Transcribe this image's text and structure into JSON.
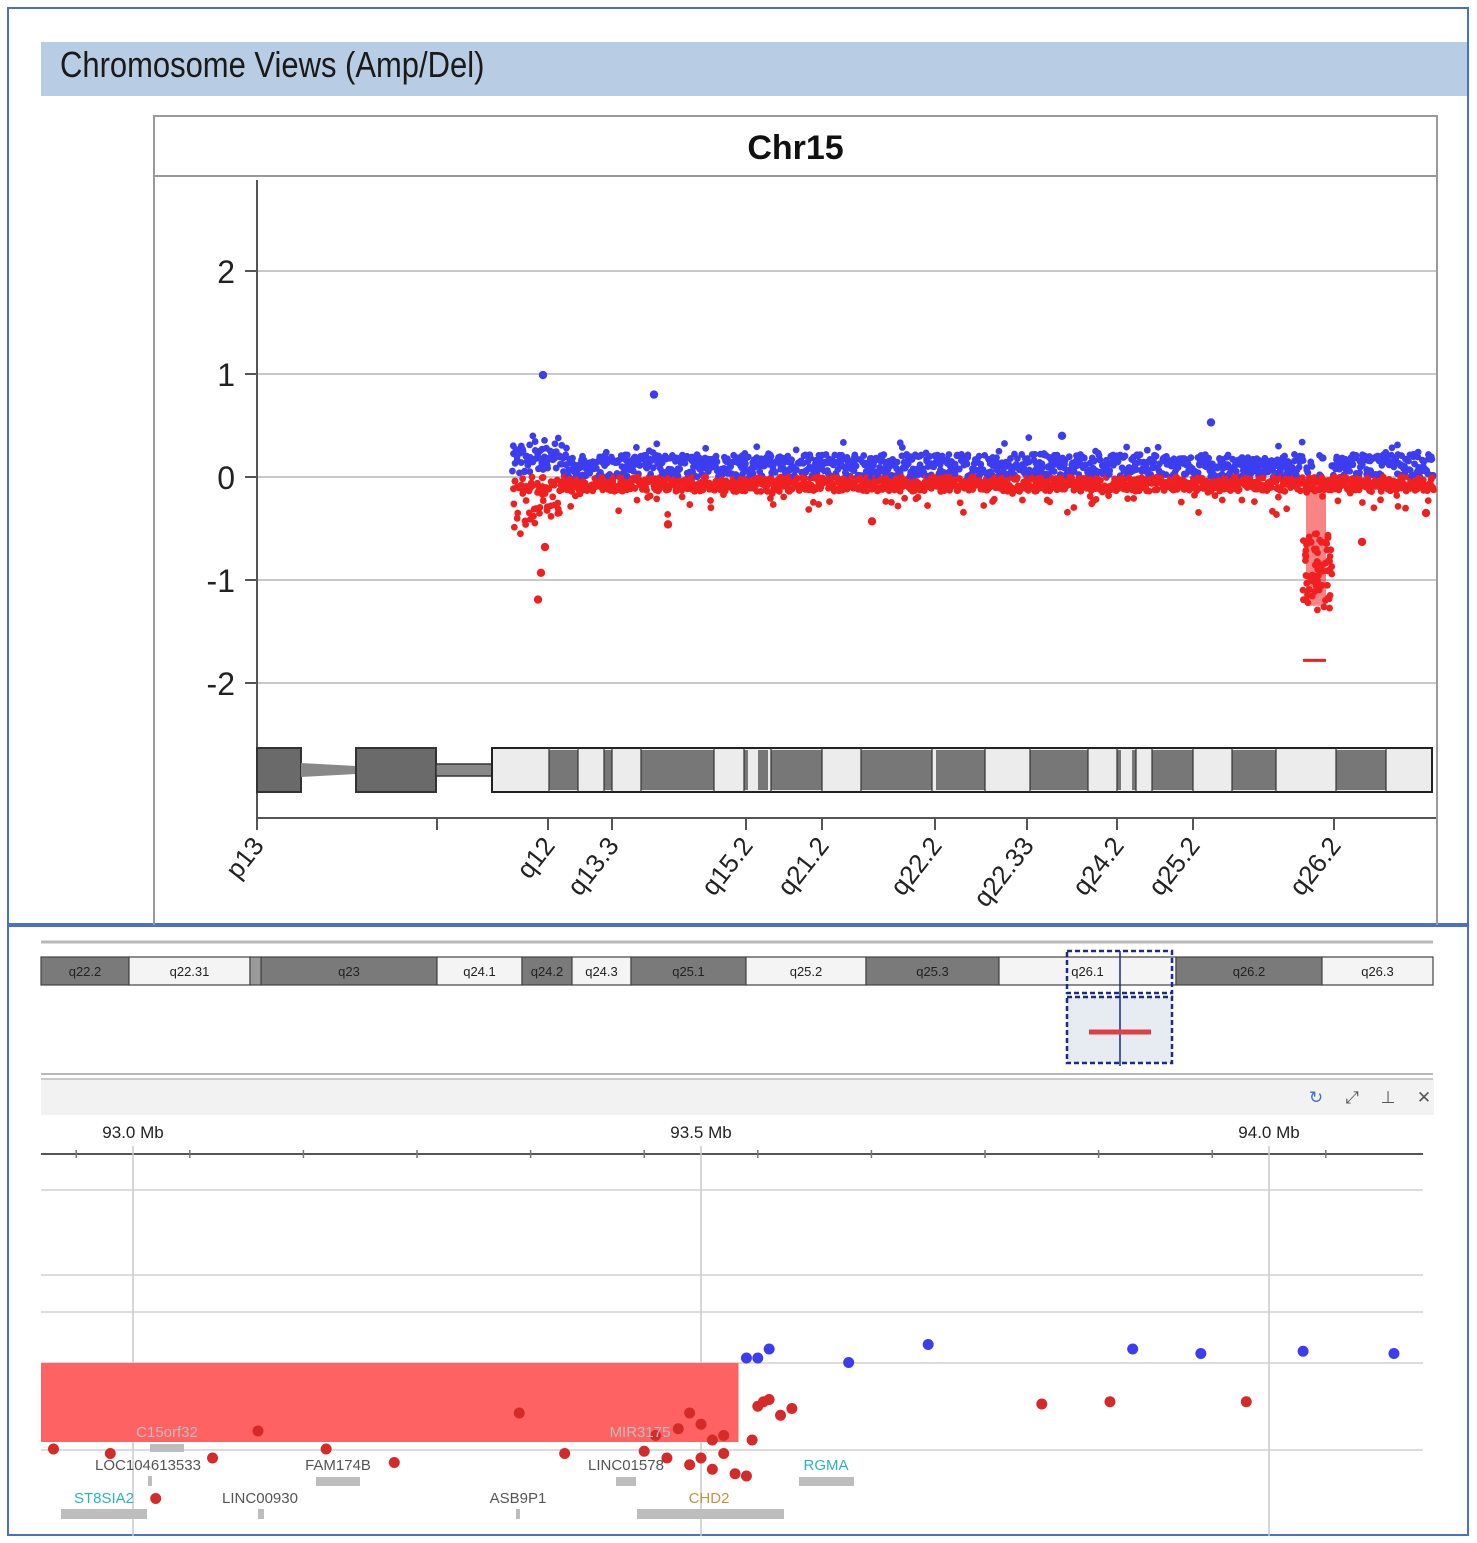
{
  "header": {
    "title": "Chromosome Views (Amp/Del)"
  },
  "chart_data": [
    {
      "type": "scatter",
      "title": "Chr15",
      "ylim": [
        -2.6,
        2.6
      ],
      "yticks": [
        "2",
        "1",
        "0",
        "-1",
        "-2"
      ],
      "ytick_values": [
        2,
        1,
        0,
        -1,
        -2
      ],
      "grid": true,
      "x_tick_labels": [
        "p13",
        "q12",
        "q13.3",
        "q15.2",
        "q21.2",
        "q22.2",
        "q22.33",
        "q24.2",
        "q25.2",
        "q26.2"
      ],
      "series": [
        {
          "color": "#3c3cf0",
          "description_only": true
        },
        {
          "color": "#f02020"
        }
      ],
      "data_start_band": "q12",
      "notable_points": [
        {
          "band": "q12",
          "value": 1.05,
          "sign": "amp"
        },
        {
          "band": "q13.3",
          "value": 0.83,
          "sign": "amp"
        },
        {
          "band": "q25.2",
          "value": 0.55,
          "sign": "amp"
        },
        {
          "band": "q12",
          "value": -1.25,
          "sign": "del"
        },
        {
          "band": "q12",
          "value": -0.95,
          "sign": "del"
        }
      ],
      "deletion_segment": {
        "band": "q26.1",
        "value": -1.0
      },
      "deletion_marker": {
        "band": "q26.1",
        "value": -2.0
      }
    },
    {
      "type": "scatter",
      "x_tick_labels": [
        "93.0 Mb",
        "93.5 Mb",
        "94.0 Mb"
      ],
      "x_ticks": [
        93.0,
        93.5,
        94.0
      ],
      "xlim": [
        92.92,
        94.13
      ],
      "deletion_region": {
        "x_start": 92.92,
        "x_end": 93.533
      },
      "blue_points": [
        {
          "x": 93.54,
          "y": 1.0
        },
        {
          "x": 93.55,
          "y": 1.0
        },
        {
          "x": 93.56,
          "y": 1.2
        },
        {
          "x": 93.63,
          "y": 0.9
        },
        {
          "x": 93.7,
          "y": 1.3
        },
        {
          "x": 93.88,
          "y": 1.2
        },
        {
          "x": 93.94,
          "y": 1.1
        },
        {
          "x": 94.03,
          "y": 1.15
        },
        {
          "x": 94.11,
          "y": 1.1
        }
      ],
      "red_points": [
        {
          "x": 92.93,
          "y": -0.2
        },
        {
          "x": 92.98,
          "y": -0.3
        },
        {
          "x": 93.02,
          "y": -1.3
        },
        {
          "x": 93.07,
          "y": -0.4
        },
        {
          "x": 93.11,
          "y": 0.2
        },
        {
          "x": 93.17,
          "y": -0.2
        },
        {
          "x": 93.23,
          "y": -0.5
        },
        {
          "x": 93.34,
          "y": 0.6
        },
        {
          "x": 93.38,
          "y": -0.3
        },
        {
          "x": 93.45,
          "y": -0.25
        },
        {
          "x": 93.46,
          "y": 0.1
        },
        {
          "x": 93.47,
          "y": -0.4
        },
        {
          "x": 93.48,
          "y": 0.25
        },
        {
          "x": 93.49,
          "y": 0.6
        },
        {
          "x": 93.49,
          "y": -0.55
        },
        {
          "x": 93.5,
          "y": 0.35
        },
        {
          "x": 93.5,
          "y": -0.4
        },
        {
          "x": 93.51,
          "y": 0.0
        },
        {
          "x": 93.51,
          "y": -0.65
        },
        {
          "x": 93.52,
          "y": -0.3
        },
        {
          "x": 93.52,
          "y": 0.1
        },
        {
          "x": 93.53,
          "y": -0.75
        },
        {
          "x": 93.54,
          "y": -0.8
        },
        {
          "x": 93.545,
          "y": 0.0
        },
        {
          "x": 93.55,
          "y": 0.75
        },
        {
          "x": 93.555,
          "y": 0.85
        },
        {
          "x": 93.56,
          "y": 0.9
        },
        {
          "x": 93.57,
          "y": 0.55
        },
        {
          "x": 93.58,
          "y": 0.7
        },
        {
          "x": 93.8,
          "y": 0.8
        },
        {
          "x": 93.86,
          "y": 0.85
        },
        {
          "x": 93.98,
          "y": 0.85
        }
      ]
    }
  ],
  "ideogram": {
    "bands": [
      {
        "label": "q22.2",
        "dark": true
      },
      {
        "label": "q22.31",
        "dark": false
      },
      {
        "label": "q23",
        "dark": true
      },
      {
        "label": "q24.1",
        "dark": false
      },
      {
        "label": "q24.2",
        "dark": true
      },
      {
        "label": "q24.3",
        "dark": false
      },
      {
        "label": "q25.1",
        "dark": true
      },
      {
        "label": "q25.2",
        "dark": false
      },
      {
        "label": "q25.3",
        "dark": true
      },
      {
        "label": "q26.1",
        "dark": false
      },
      {
        "label": "q26.2",
        "dark": true
      },
      {
        "label": "q26.3",
        "dark": false
      }
    ]
  },
  "genes": [
    {
      "name": "LOC104613533",
      "color": "#555555"
    },
    {
      "name": "FAM174B",
      "color": "#555555"
    },
    {
      "name": "LINC01578",
      "color": "#555555"
    },
    {
      "name": "RGMA",
      "color": "#2ab5b5"
    },
    {
      "name": "ST8SIA2",
      "color": "#2ab5b5"
    },
    {
      "name": "LINC00930",
      "color": "#555555"
    },
    {
      "name": "ASB9P1",
      "color": "#555555"
    },
    {
      "name": "CHD2",
      "color": "#c89040"
    },
    {
      "name": "C15orf32",
      "color": "#bdbdbd"
    },
    {
      "name": "MIR3175",
      "color": "#bdbdbd"
    }
  ],
  "toolbar": {
    "icons": [
      "refresh-icon",
      "expand-icon",
      "pin-icon",
      "close-icon"
    ],
    "glyphs": [
      "↻",
      "⤢",
      "⊥",
      "✕"
    ]
  },
  "colors": {
    "amp": "#3c3cf0",
    "del": "#f02020",
    "header": "#b8cce4",
    "frame": "#4a72c4"
  }
}
